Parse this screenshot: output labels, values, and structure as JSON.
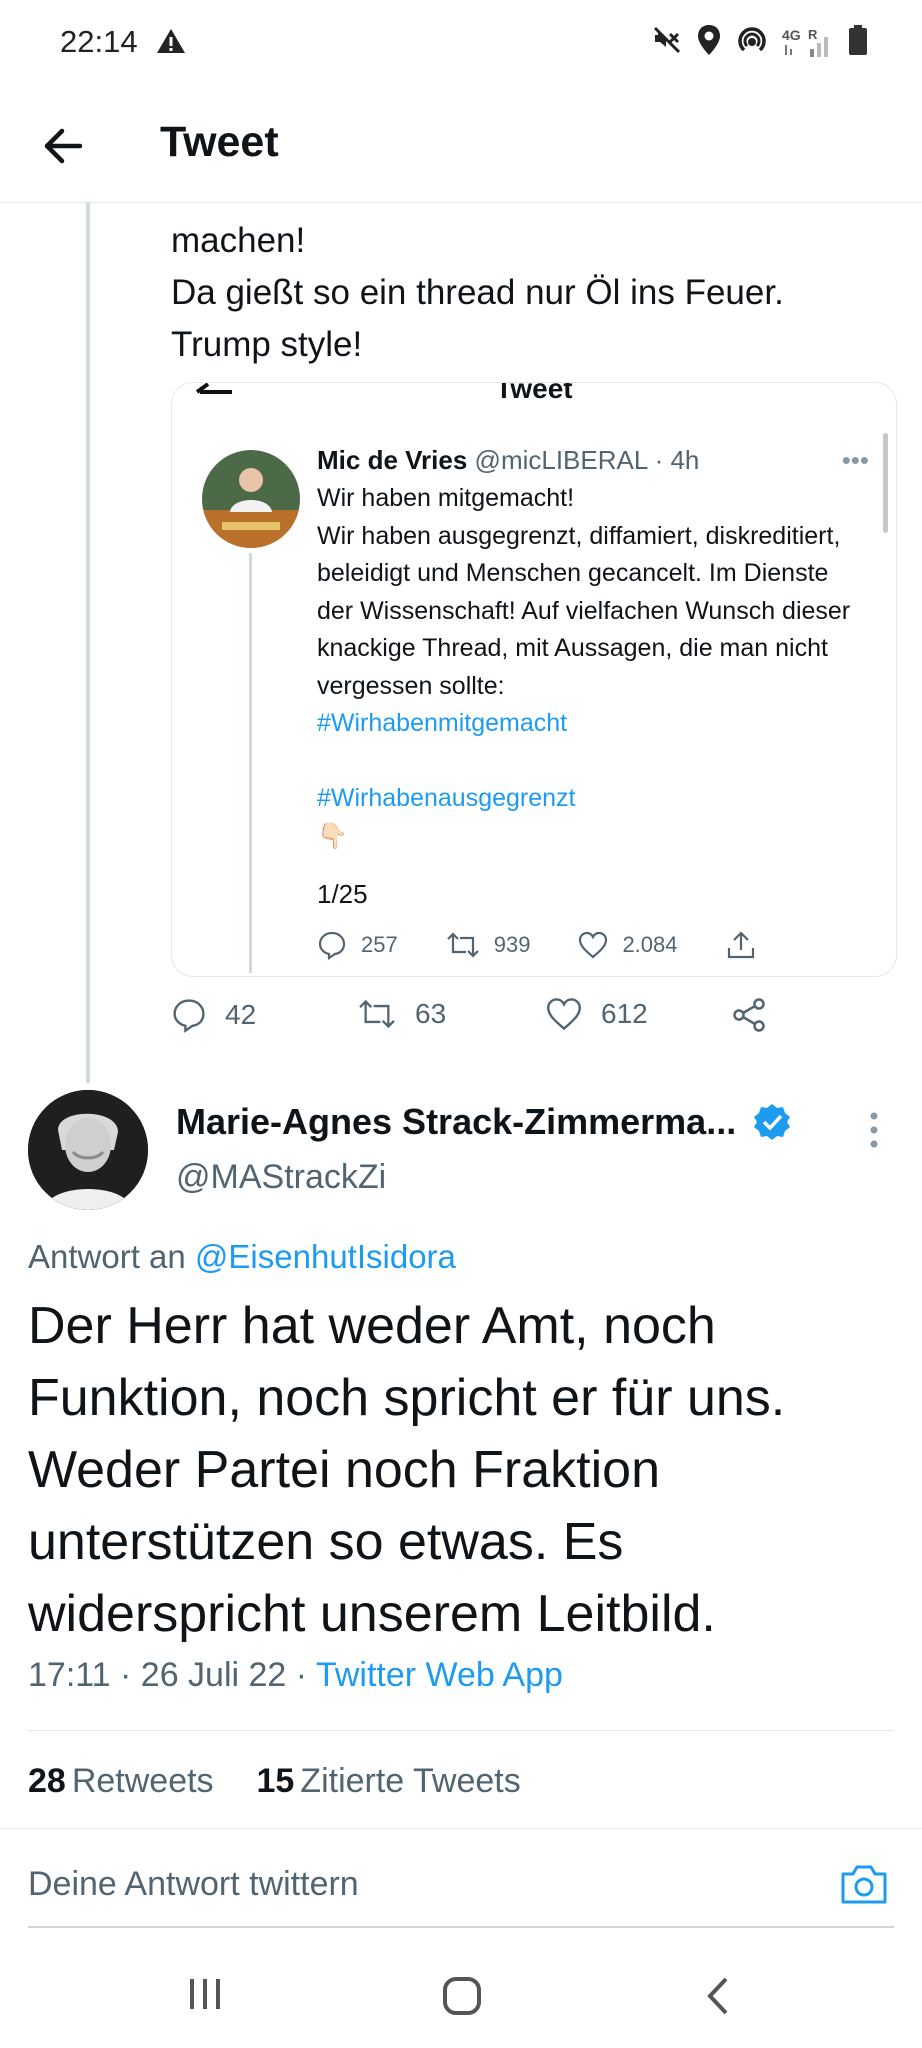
{
  "status_bar": {
    "time": "22:14",
    "network_label": "4G",
    "roaming_label": "R",
    "icons": [
      "warning-icon",
      "vibrate-off-icon",
      "location-icon",
      "hotspot-icon",
      "signal-icon",
      "battery-icon"
    ]
  },
  "header": {
    "title": "Tweet",
    "back_icon": "arrow-left-icon"
  },
  "parent_tweet": {
    "text": "machen!\nDa gießt so ein thread nur Öl ins Feuer.\nTrump style!",
    "embedded_screenshot": {
      "header_title": "Tweet",
      "author_name": "Mic de Vries",
      "author_handle": "@micLIBERAL",
      "time": "· 4h",
      "text": "Wir haben mitgemacht!\nWir haben ausgegrenzt, diffamiert, diskreditiert, beleidigt und Menschen gecancelt. Im Dienste der Wissenschaft! Auf vielfachen Wunsch dieser knackige Thread, mit Aussagen, die man nicht vergessen sollte:",
      "hashtag1": "#Wirhabenmitgemacht",
      "hashtag2": "#Wirhabenausgegrenzt",
      "emoji": "👇🏻",
      "thread_count": "1/25",
      "replies": "257",
      "retweets": "939",
      "likes": "2.084"
    },
    "replies": "42",
    "retweets": "63",
    "likes": "612"
  },
  "main_tweet": {
    "author_name": "Marie-Agnes Strack-Zimmerma...",
    "author_handle": "@MAStrackZi",
    "reply_prefix": "Antwort an",
    "reply_target": "@EisenhutIsidora",
    "text": "Der Herr hat weder Amt, noch Funktion, noch spricht er für uns. Weder Partei noch Fraktion unterstützen so etwas. Es widerspricht unserem Leitbild.",
    "time": "17:11",
    "date": "26 Juli 22",
    "separator": "·",
    "source": "Twitter Web App",
    "retweet_count": "28",
    "retweet_label": "Retweets",
    "quote_count": "15",
    "quote_label": "Zitierte Tweets"
  },
  "reply_bar": {
    "placeholder": "Deine Antwort twittern"
  },
  "colors": {
    "accent": "#1d9bf0",
    "text": "#0f1419",
    "secondary": "#536471",
    "border": "#e1e8ed"
  }
}
